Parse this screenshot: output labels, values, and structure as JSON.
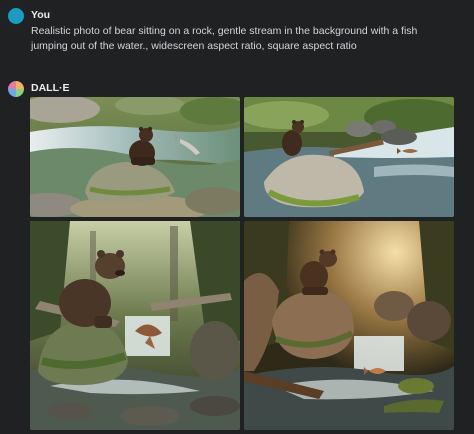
{
  "user_message": {
    "author": "You",
    "text": "Realistic photo of bear sitting on a rock, gentle stream in the background with a fish jumping out of the water., widescreen aspect ratio, square aspect ratio"
  },
  "assistant_message": {
    "author": "DALL·E",
    "images": [
      {
        "icon": "generated-image-1"
      },
      {
        "icon": "generated-image-2"
      },
      {
        "icon": "generated-image-3"
      },
      {
        "icon": "generated-image-4"
      }
    ]
  },
  "colors": {
    "background": "#202123",
    "user_avatar": "#1a9bc4",
    "text": "#ececf1"
  }
}
